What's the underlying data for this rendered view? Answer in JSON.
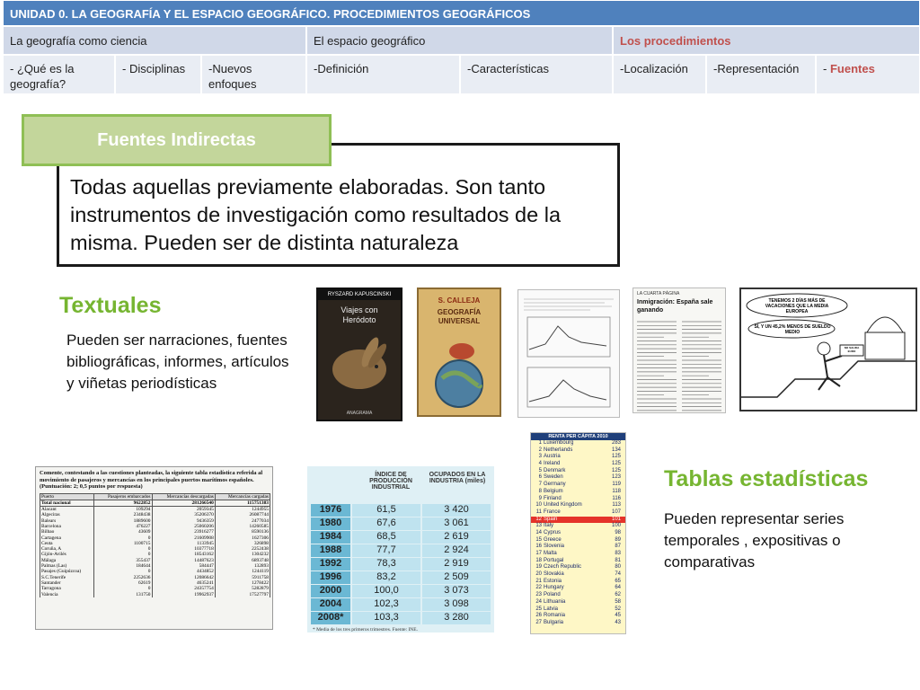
{
  "nav": {
    "unit_title": "UNIDAD 0.  LA GEOGRAFÍA Y EL ESPACIO GEOGRÁFICO. PROCEDIMIENTOS GEOGRÁFICOS",
    "sections": [
      "La geografía como ciencia",
      "El espacio geográfico",
      "Los procedimientos"
    ],
    "subsections": [
      "-  ¿Qué es la geografía?",
      "- Disciplinas",
      "-Nuevos enfoques",
      "-Definición",
      "-Características",
      "-Localización",
      "-Representación",
      "- ",
      "Fuentes"
    ]
  },
  "heading": "Fuentes Indirectas",
  "definition": "Todas aquellas previamente elaboradas. Son tanto instrumentos de investigación como resultados de la misma. Pueden ser de distinta naturaleza",
  "textuales": {
    "title": "Textuales",
    "desc": "Pueden ser narraciones, fuentes bibliográficas, informes, artículos y viñetas periodísticas",
    "book1": {
      "author": "RYSZARD KAPUSCINSKI",
      "title": "Viajes con Heródoto",
      "publisher": "ANAGRAMA"
    },
    "book2": {
      "author": "S. CALLEJA",
      "title": "GEOGRAFÍA UNIVERSAL"
    },
    "article": {
      "header": "LA CUARTA PÁGINA",
      "title": "Inmigración: España sale ganando"
    },
    "cartoon": {
      "speech1": "TENEMOS 2 DÍAS MÁS DE VACACIONES QUE LA MEDIA EUROPEA",
      "speech2": "SÍ, Y UN 45,2% MENOS DE SUELDO MEDIO",
      "sign": "NO SALIDA EURO"
    }
  },
  "tablas": {
    "title": "Tablas estadísticas",
    "desc": "Pueden representar series temporales , expositivas o comparativas",
    "table1": {
      "caption": "Comente, contestando a las cuestiones planteadas, la siguiente tabla estadística referida al movimiento de pasajeros y mercancías en los principales puertos marítimos españoles. (Puntuación: 2; 0,5 puntos por respuesta)",
      "headers": [
        "Puerto",
        "Pasajeros embarcados",
        "Mercancías descargadas",
        "Mercancías cargadas"
      ],
      "rows": [
        [
          "Total nacional",
          "9622852",
          "281266540",
          "115751383"
        ],
        [
          "Alacant",
          "109294",
          "2059345",
          "1244955"
        ],
        [
          "Algeciras",
          "2348438",
          "35206370",
          "26087744"
        ],
        [
          "Balears",
          "1889600",
          "9436359",
          "2477034"
        ],
        [
          "Barcelona",
          "476227",
          "25060206",
          "14260585"
        ],
        [
          "Bilbao",
          "43609",
          "23916277",
          "8590136"
        ],
        [
          "Cartagena",
          "0",
          "21609908",
          "1627306"
        ],
        [
          "Ceuta",
          "1100715",
          "1133945",
          "326898"
        ],
        [
          "Coruña, A",
          "0",
          "10377718",
          "2252438"
        ],
        [
          "Gijón-Avilés",
          "0",
          "18543162",
          "1304232"
        ],
        [
          "Málaga",
          "355437",
          "14487623",
          "6893748"
        ],
        [
          "Palmas (Las)",
          "184644",
          "584447",
          "132893"
        ],
        [
          "Pasajes (Guipúzcoa)",
          "0",
          "4434852",
          "1244119"
        ],
        [
          "S.C.Tenerife",
          "2252636",
          "12086642",
          "5911758"
        ],
        [
          "Santander",
          "62619",
          "4635241",
          "1278422"
        ],
        [
          "Tarragona",
          "0",
          "24357754",
          "5282879"
        ],
        [
          "Valencia",
          "131750",
          "19962937",
          "17527797"
        ]
      ]
    },
    "table2": {
      "headers": [
        "ÍNDICE DE PRODUCCIÓN INDUSTRIAL",
        "OCUPADOS EN LA INDUSTRIA (miles)"
      ],
      "rows": [
        [
          "1976",
          "61,5",
          "3 420"
        ],
        [
          "1980",
          "67,6",
          "3 061"
        ],
        [
          "1984",
          "68,5",
          "2 619"
        ],
        [
          "1988",
          "77,7",
          "2 924"
        ],
        [
          "1992",
          "78,3",
          "2 919"
        ],
        [
          "1996",
          "83,2",
          "2 509"
        ],
        [
          "2000",
          "100,0",
          "3 073"
        ],
        [
          "2004",
          "102,3",
          "3 098"
        ],
        [
          "2008*",
          "103,3",
          "3 280"
        ]
      ],
      "note": "* Media de los tres primeros trimestres. Fuente: INE."
    },
    "table3": {
      "title": "RENTA PER CÁPITA 2010",
      "rows": [
        [
          "1",
          "Luxembourg",
          "283"
        ],
        [
          "2",
          "Netherlands",
          "134"
        ],
        [
          "3",
          "Austria",
          "125"
        ],
        [
          "4",
          "Ireland",
          "125"
        ],
        [
          "5",
          "Denmark",
          "125"
        ],
        [
          "6",
          "Sweden",
          "123"
        ],
        [
          "7",
          "Germany",
          "119"
        ],
        [
          "8",
          "Belgium",
          "118"
        ],
        [
          "9",
          "Finland",
          "116"
        ],
        [
          "10",
          "United Kingdom",
          "113"
        ],
        [
          "11",
          "France",
          "107"
        ],
        [
          "12",
          "Spain",
          "101"
        ],
        [
          "13",
          "Italy",
          "100"
        ],
        [
          "14",
          "Cyprus",
          "98"
        ],
        [
          "15",
          "Greece",
          "89"
        ],
        [
          "16",
          "Slovenia",
          "87"
        ],
        [
          "17",
          "Malta",
          "83"
        ],
        [
          "18",
          "Portugal",
          "81"
        ],
        [
          "19",
          "Czech Republic",
          "80"
        ],
        [
          "20",
          "Slovakia",
          "74"
        ],
        [
          "21",
          "Estonia",
          "65"
        ],
        [
          "22",
          "Hungary",
          "64"
        ],
        [
          "23",
          "Poland",
          "62"
        ],
        [
          "24",
          "Lithuania",
          "58"
        ],
        [
          "25",
          "Latvia",
          "52"
        ],
        [
          "26",
          "Romania",
          "45"
        ],
        [
          "27",
          "Bulgaria",
          "43"
        ]
      ],
      "highlight_row": 12
    }
  }
}
